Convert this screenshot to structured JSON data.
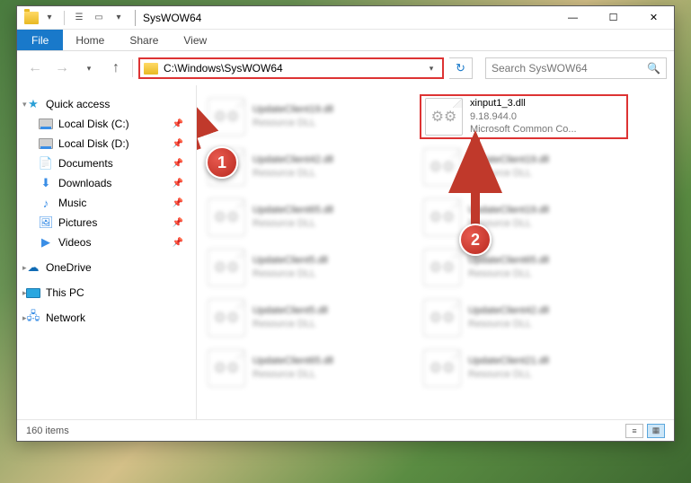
{
  "window": {
    "title": "SysWOW64"
  },
  "ribbon": {
    "file": "File",
    "tabs": [
      "Home",
      "Share",
      "View"
    ]
  },
  "address": {
    "path": "C:\\Windows\\SysWOW64"
  },
  "search": {
    "placeholder": "Search SysWOW64"
  },
  "sidebar": {
    "quick_access": "Quick access",
    "items": [
      {
        "label": "Local Disk (C:)",
        "icon": "drive",
        "pinned": true
      },
      {
        "label": "Local Disk (D:)",
        "icon": "drive",
        "pinned": true
      },
      {
        "label": "Documents",
        "icon": "doc",
        "pinned": true
      },
      {
        "label": "Downloads",
        "icon": "down",
        "pinned": true
      },
      {
        "label": "Music",
        "icon": "music",
        "pinned": true
      },
      {
        "label": "Pictures",
        "icon": "pic",
        "pinned": true
      },
      {
        "label": "Videos",
        "icon": "vid",
        "pinned": true
      }
    ],
    "onedrive": "OneDrive",
    "this_pc": "This PC",
    "network": "Network"
  },
  "files": {
    "highlight": {
      "name": "xinput1_3.dll",
      "version": "9.18.944.0",
      "desc": "Microsoft Common Co..."
    },
    "blurred": [
      {
        "name": "UpdateClient19.dll",
        "sub": "Resource DLL"
      },
      {
        "name": "UpdateClient42.dll",
        "sub": "Resource DLL"
      },
      {
        "name": "UpdateClient19.dll",
        "sub": "Resource DLL"
      },
      {
        "name": "UpdateClient65.dll",
        "sub": "Resource DLL"
      },
      {
        "name": "UpdateClient19.dll",
        "sub": "Resource DLL"
      },
      {
        "name": "UpdateClient5.dll",
        "sub": "Resource DLL"
      },
      {
        "name": "UpdateClient65.dll",
        "sub": "Resource DLL"
      },
      {
        "name": "UpdateClient5.dll",
        "sub": "Resource DLL"
      },
      {
        "name": "UpdateClient42.dll",
        "sub": "Resource DLL"
      },
      {
        "name": "UpdateClient65.dll",
        "sub": "Resource DLL"
      },
      {
        "name": "UpdateClient21.dll",
        "sub": "Resource DLL"
      }
    ]
  },
  "callouts": {
    "one": "1",
    "two": "2"
  },
  "status": {
    "count": "160 items"
  }
}
